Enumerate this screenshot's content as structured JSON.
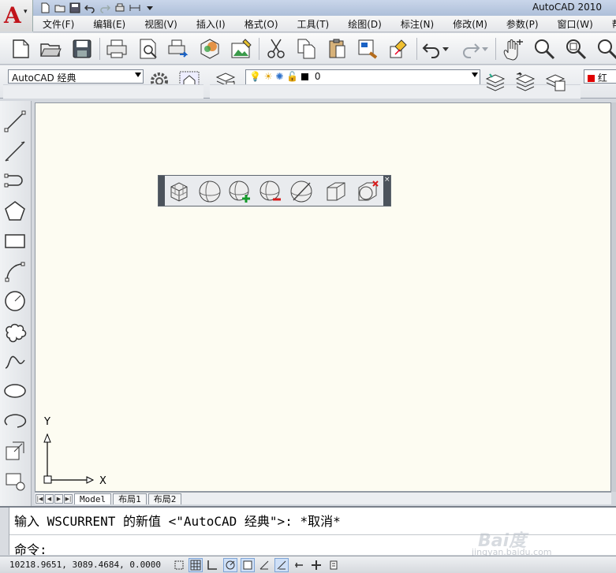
{
  "app": {
    "title": "AutoCAD 2010",
    "logo_letter": "A"
  },
  "menu": [
    {
      "label": "文件(F)"
    },
    {
      "label": "编辑(E)"
    },
    {
      "label": "视图(V)"
    },
    {
      "label": "插入(I)"
    },
    {
      "label": "格式(O)"
    },
    {
      "label": "工具(T)"
    },
    {
      "label": "绘图(D)"
    },
    {
      "label": "标注(N)"
    },
    {
      "label": "修改(M)"
    },
    {
      "label": "参数(P)"
    },
    {
      "label": "窗口(W)"
    },
    {
      "label": "帮助"
    }
  ],
  "workspace": {
    "current": "AutoCAD 经典"
  },
  "layer": {
    "current": "0"
  },
  "color_control": {
    "value": "红",
    "swatch": "#e00000"
  },
  "layout_tabs": [
    {
      "label": "Model",
      "active": true
    },
    {
      "label": "布局1"
    },
    {
      "label": "布局2"
    }
  ],
  "command": {
    "history": "输入 WSCURRENT 的新值 <\"AutoCAD 经典\">: *取消*",
    "prompt": "命令:"
  },
  "status": {
    "coordinates": "10218.9651, 3089.4684, 0.0000"
  },
  "ucs": {
    "x_label": "X",
    "y_label": "Y"
  },
  "watermark": {
    "text": "Bai度",
    "url": "jingyan.baidu.com"
  },
  "colors": {
    "canvas": "#fdfcf2",
    "accent": "#c1141b",
    "orbit_toolbar": "#4c535c"
  }
}
